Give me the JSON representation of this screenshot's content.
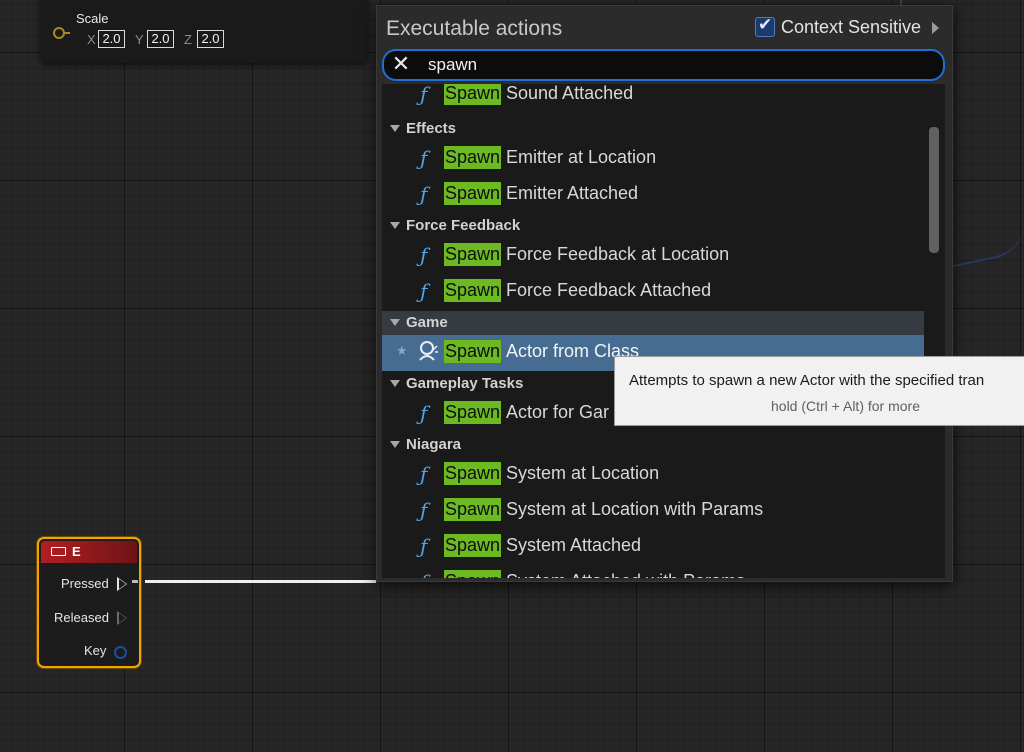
{
  "scale_node": {
    "label": "Scale",
    "x_label": "X",
    "x_value": "2.0",
    "y_label": "Y",
    "y_value": "2.0",
    "z_label": "Z",
    "z_value": "2.0"
  },
  "e_node": {
    "title": "E",
    "pins": {
      "pressed": "Pressed",
      "released": "Released",
      "key": "Key"
    }
  },
  "action_menu": {
    "title": "Executable actions",
    "context_sensitive_label": "Context Sensitive",
    "context_sensitive_checked": true,
    "search_value": "spawn",
    "highlight": "Spawn",
    "rows": {
      "sound_attached": "Sound Attached",
      "cat_effects": "Effects",
      "emitter_at_location": "Emitter at Location",
      "emitter_attached": "Emitter Attached",
      "cat_force_feedback": "Force Feedback",
      "ff_at_location": "Force Feedback at Location",
      "ff_attached": "Force Feedback Attached",
      "cat_game": "Game",
      "actor_from_class": "Actor from Class",
      "cat_gameplay_tasks": "Gameplay Tasks",
      "actor_for_gameplay": "Actor for Gar",
      "cat_niagara": "Niagara",
      "system_at_location": "System at Location",
      "system_at_location_params": "System at Location with Params",
      "system_attached": "System Attached",
      "system_attached_params": "System Attached with Params"
    }
  },
  "tooltip": {
    "text": "Attempts to spawn a new Actor with the specified tran",
    "hint": "hold (Ctrl + Alt) for more"
  },
  "colors": {
    "highlight": "#6cb922",
    "selected_row": "#476c92",
    "function_icon": "#4fa3e8",
    "node_border": "#f0a500",
    "search_border": "#1f6fd6"
  }
}
